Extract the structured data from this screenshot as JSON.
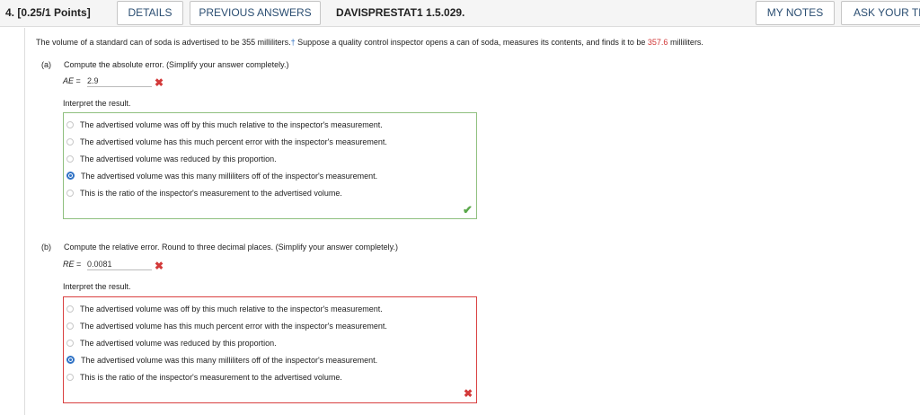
{
  "header": {
    "question_number": "4.",
    "points": "[0.25/1 Points]",
    "details_label": "DETAILS",
    "previous_answers_label": "PREVIOUS ANSWERS",
    "course_id": "DAVISPRESTAT1 1.5.029.",
    "my_notes_label": "MY NOTES",
    "ask_label": "ASK YOUR TEACHER"
  },
  "problem": {
    "text_before": "The volume of a standard can of soda is advertised to be 355 milliliters.",
    "dagger": "†",
    "text_middle": " Suppose a quality control inspector opens a can of soda, measures its contents, and finds it to be ",
    "highlight_value": "357.6",
    "text_after": " milliliters."
  },
  "part_a": {
    "label": "(a)",
    "prompt": "Compute the absolute error. (Simplify your answer completely.)",
    "var": "AE",
    "equals": " = ",
    "answer": "2.9",
    "interpret_label": "Interpret the result.",
    "choices": [
      "The advertised volume was off by this much relative to the inspector's measurement.",
      "The advertised volume has this much percent error with the inspector's measurement.",
      "The advertised volume was reduced by this proportion.",
      "The advertised volume was this many milliliters off of the inspector's measurement.",
      "This is the ratio of the inspector's measurement to the advertised volume."
    ],
    "selected_index": 3,
    "answer_status": "incorrect",
    "interpret_status": "correct"
  },
  "part_b": {
    "label": "(b)",
    "prompt": "Compute the relative error. Round to three decimal places. (Simplify your answer completely.)",
    "var": "RE",
    "equals": " = ",
    "answer": "0.0081",
    "interpret_label": "Interpret the result.",
    "choices": [
      "The advertised volume was off by this much relative to the inspector's measurement.",
      "The advertised volume has this much percent error with the inspector's measurement.",
      "The advertised volume was reduced by this proportion.",
      "The advertised volume was this many milliliters off of the inspector's measurement.",
      "This is the ratio of the inspector's measurement to the advertised volume."
    ],
    "selected_index": 3,
    "answer_status": "incorrect",
    "interpret_status": "incorrect"
  },
  "icons": {
    "incorrect": "✖",
    "correct": "✔"
  },
  "colors": {
    "link_blue": "#2b4e72",
    "accent_blue": "#2f72c5",
    "error_red": "#d33a3a",
    "correct_green": "#5aa84a"
  }
}
